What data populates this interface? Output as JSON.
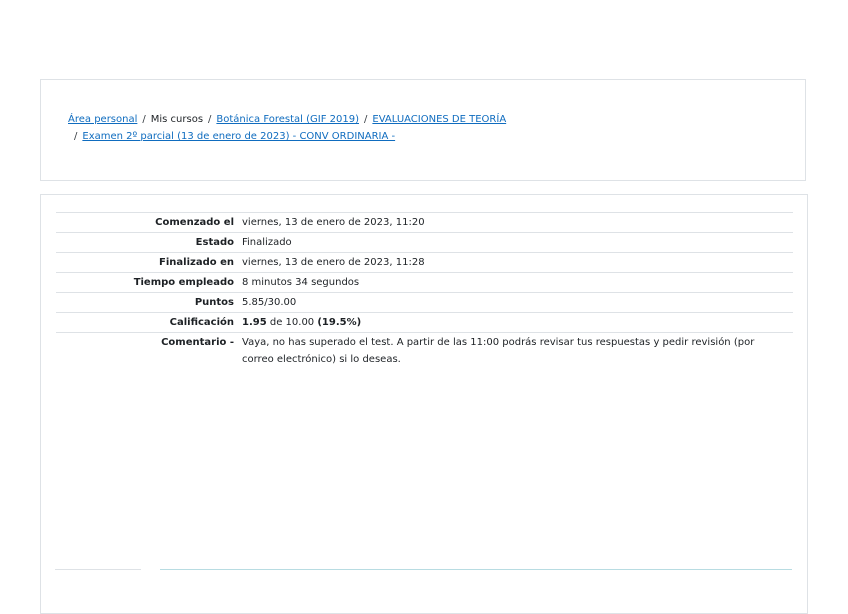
{
  "breadcrumb": {
    "home": "Área personal",
    "my_courses": "Mis cursos",
    "course": "Botánica Forestal (GIF 2019)",
    "section": "EVALUACIONES DE TEORÍA",
    "quiz": "Examen 2º parcial (13 de enero de 2023) - CONV ORDINARIA -",
    "separator": "/"
  },
  "summary": {
    "started_label": "Comenzado el",
    "started_value": "viernes, 13 de enero de 2023, 11:20",
    "state_label": "Estado",
    "state_value": "Finalizado",
    "completed_label": "Finalizado en",
    "completed_value": "viernes, 13 de enero de 2023, 11:28",
    "time_label": "Tiempo empleado",
    "time_value": "8 minutos 34 segundos",
    "marks_label": "Puntos",
    "marks_value": "5.85/30.00",
    "grade_label": "Calificación",
    "grade_score": "1.95",
    "grade_of": " de 10.00 ",
    "grade_percent": "(19.5%)",
    "feedback_label": "Comentario -",
    "feedback_value": "Vaya, no has superado el test. A partir de las 11:00 podrás revisar tus respuestas y pedir revisión (por correo electrónico) si lo deseas."
  }
}
